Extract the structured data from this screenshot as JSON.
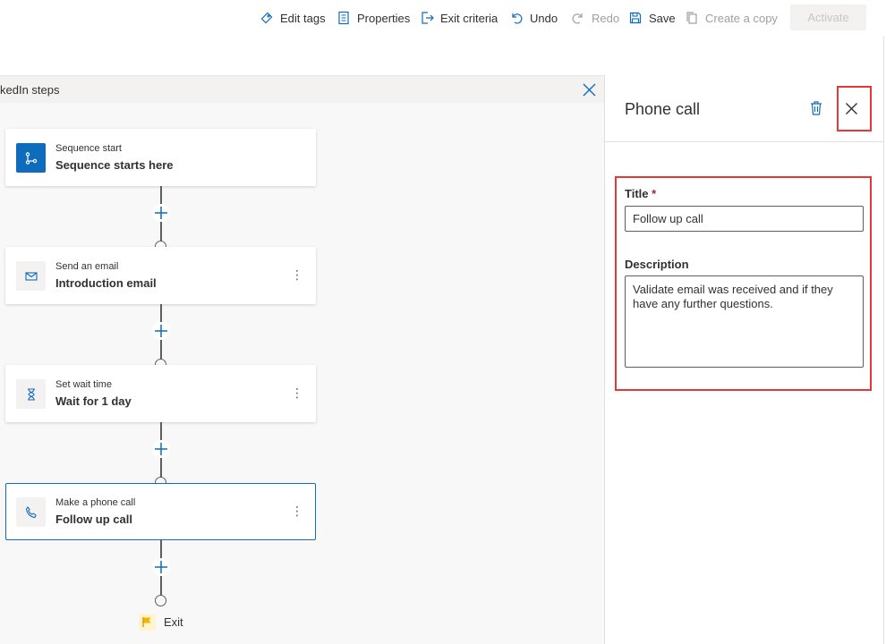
{
  "toolbar": {
    "edit_tags": "Edit tags",
    "properties": "Properties",
    "exit_criteria": "Exit criteria",
    "undo": "Undo",
    "redo": "Redo",
    "save": "Save",
    "create_copy": "Create a copy",
    "activate": "Activate"
  },
  "canvas": {
    "title": "kedIn steps"
  },
  "steps": [
    {
      "subtitle": "Sequence start",
      "title": "Sequence starts here",
      "icon": "sequence-start-icon"
    },
    {
      "subtitle": "Send an email",
      "title": "Introduction email",
      "icon": "email-icon"
    },
    {
      "subtitle": "Set wait time",
      "title": "Wait for 1 day",
      "icon": "hourglass-icon"
    },
    {
      "subtitle": "Make a phone call",
      "title": "Follow up call",
      "icon": "phone-icon"
    }
  ],
  "exit_label": "Exit",
  "panel": {
    "title": "Phone call",
    "title_label": "Title",
    "required_mark": "*",
    "title_value": "Follow up call",
    "description_label": "Description",
    "description_value": "Validate email was received and if they have any further questions."
  },
  "colors": {
    "accent": "#0f6cbd",
    "highlight": "#e5383b"
  }
}
